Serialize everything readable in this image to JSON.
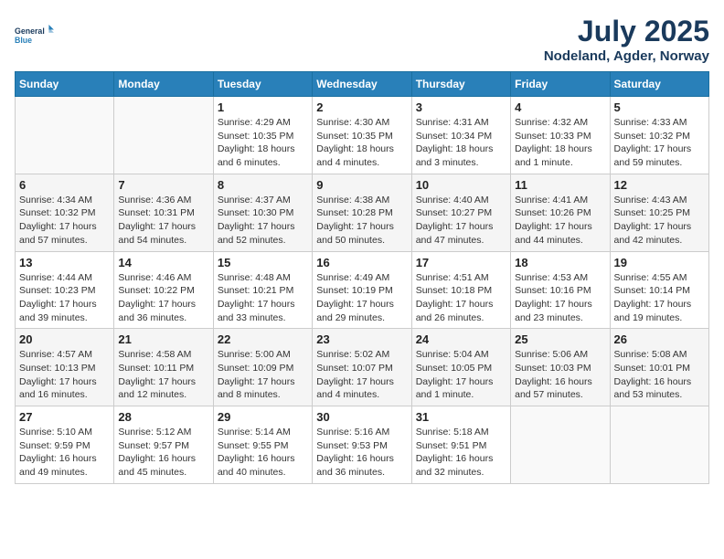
{
  "logo": {
    "line1": "General",
    "line2": "Blue"
  },
  "title": "July 2025",
  "location": "Nodeland, Agder, Norway",
  "days_header": [
    "Sunday",
    "Monday",
    "Tuesday",
    "Wednesday",
    "Thursday",
    "Friday",
    "Saturday"
  ],
  "weeks": [
    [
      {
        "num": "",
        "info": ""
      },
      {
        "num": "",
        "info": ""
      },
      {
        "num": "1",
        "info": "Sunrise: 4:29 AM\nSunset: 10:35 PM\nDaylight: 18 hours\nand 6 minutes."
      },
      {
        "num": "2",
        "info": "Sunrise: 4:30 AM\nSunset: 10:35 PM\nDaylight: 18 hours\nand 4 minutes."
      },
      {
        "num": "3",
        "info": "Sunrise: 4:31 AM\nSunset: 10:34 PM\nDaylight: 18 hours\nand 3 minutes."
      },
      {
        "num": "4",
        "info": "Sunrise: 4:32 AM\nSunset: 10:33 PM\nDaylight: 18 hours\nand 1 minute."
      },
      {
        "num": "5",
        "info": "Sunrise: 4:33 AM\nSunset: 10:32 PM\nDaylight: 17 hours\nand 59 minutes."
      }
    ],
    [
      {
        "num": "6",
        "info": "Sunrise: 4:34 AM\nSunset: 10:32 PM\nDaylight: 17 hours\nand 57 minutes."
      },
      {
        "num": "7",
        "info": "Sunrise: 4:36 AM\nSunset: 10:31 PM\nDaylight: 17 hours\nand 54 minutes."
      },
      {
        "num": "8",
        "info": "Sunrise: 4:37 AM\nSunset: 10:30 PM\nDaylight: 17 hours\nand 52 minutes."
      },
      {
        "num": "9",
        "info": "Sunrise: 4:38 AM\nSunset: 10:28 PM\nDaylight: 17 hours\nand 50 minutes."
      },
      {
        "num": "10",
        "info": "Sunrise: 4:40 AM\nSunset: 10:27 PM\nDaylight: 17 hours\nand 47 minutes."
      },
      {
        "num": "11",
        "info": "Sunrise: 4:41 AM\nSunset: 10:26 PM\nDaylight: 17 hours\nand 44 minutes."
      },
      {
        "num": "12",
        "info": "Sunrise: 4:43 AM\nSunset: 10:25 PM\nDaylight: 17 hours\nand 42 minutes."
      }
    ],
    [
      {
        "num": "13",
        "info": "Sunrise: 4:44 AM\nSunset: 10:23 PM\nDaylight: 17 hours\nand 39 minutes."
      },
      {
        "num": "14",
        "info": "Sunrise: 4:46 AM\nSunset: 10:22 PM\nDaylight: 17 hours\nand 36 minutes."
      },
      {
        "num": "15",
        "info": "Sunrise: 4:48 AM\nSunset: 10:21 PM\nDaylight: 17 hours\nand 33 minutes."
      },
      {
        "num": "16",
        "info": "Sunrise: 4:49 AM\nSunset: 10:19 PM\nDaylight: 17 hours\nand 29 minutes."
      },
      {
        "num": "17",
        "info": "Sunrise: 4:51 AM\nSunset: 10:18 PM\nDaylight: 17 hours\nand 26 minutes."
      },
      {
        "num": "18",
        "info": "Sunrise: 4:53 AM\nSunset: 10:16 PM\nDaylight: 17 hours\nand 23 minutes."
      },
      {
        "num": "19",
        "info": "Sunrise: 4:55 AM\nSunset: 10:14 PM\nDaylight: 17 hours\nand 19 minutes."
      }
    ],
    [
      {
        "num": "20",
        "info": "Sunrise: 4:57 AM\nSunset: 10:13 PM\nDaylight: 17 hours\nand 16 minutes."
      },
      {
        "num": "21",
        "info": "Sunrise: 4:58 AM\nSunset: 10:11 PM\nDaylight: 17 hours\nand 12 minutes."
      },
      {
        "num": "22",
        "info": "Sunrise: 5:00 AM\nSunset: 10:09 PM\nDaylight: 17 hours\nand 8 minutes."
      },
      {
        "num": "23",
        "info": "Sunrise: 5:02 AM\nSunset: 10:07 PM\nDaylight: 17 hours\nand 4 minutes."
      },
      {
        "num": "24",
        "info": "Sunrise: 5:04 AM\nSunset: 10:05 PM\nDaylight: 17 hours\nand 1 minute."
      },
      {
        "num": "25",
        "info": "Sunrise: 5:06 AM\nSunset: 10:03 PM\nDaylight: 16 hours\nand 57 minutes."
      },
      {
        "num": "26",
        "info": "Sunrise: 5:08 AM\nSunset: 10:01 PM\nDaylight: 16 hours\nand 53 minutes."
      }
    ],
    [
      {
        "num": "27",
        "info": "Sunrise: 5:10 AM\nSunset: 9:59 PM\nDaylight: 16 hours\nand 49 minutes."
      },
      {
        "num": "28",
        "info": "Sunrise: 5:12 AM\nSunset: 9:57 PM\nDaylight: 16 hours\nand 45 minutes."
      },
      {
        "num": "29",
        "info": "Sunrise: 5:14 AM\nSunset: 9:55 PM\nDaylight: 16 hours\nand 40 minutes."
      },
      {
        "num": "30",
        "info": "Sunrise: 5:16 AM\nSunset: 9:53 PM\nDaylight: 16 hours\nand 36 minutes."
      },
      {
        "num": "31",
        "info": "Sunrise: 5:18 AM\nSunset: 9:51 PM\nDaylight: 16 hours\nand 32 minutes."
      },
      {
        "num": "",
        "info": ""
      },
      {
        "num": "",
        "info": ""
      }
    ]
  ]
}
